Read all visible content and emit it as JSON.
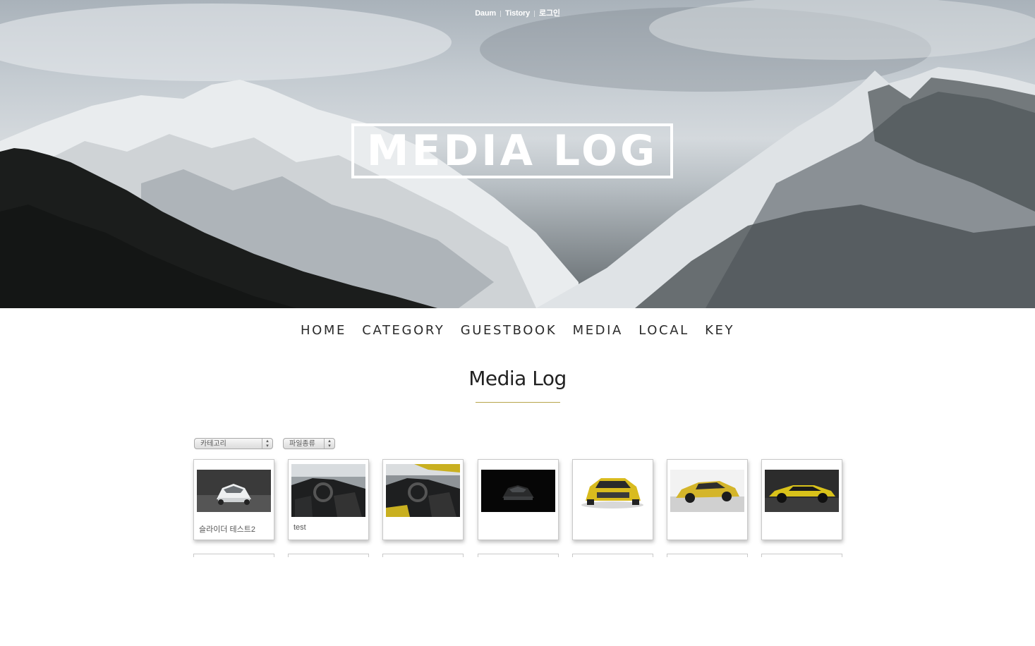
{
  "top_links": [
    "Daum",
    "Tistory",
    "로그인"
  ],
  "logo": "MEDIA LOG",
  "nav": [
    "HOME",
    "CATEGORY",
    "GUESTBOOK",
    "MEDIA",
    "LOCAL",
    "KEY"
  ],
  "page_title": "Media Log",
  "filters": {
    "category": "카테고리",
    "file_type": "파일종류"
  },
  "media_items": [
    {
      "caption": "슬라이더 테스트2",
      "image": "white-sports-car"
    },
    {
      "caption": "test",
      "image": "car-interior"
    },
    {
      "caption": "",
      "image": "car-interior-yellow"
    },
    {
      "caption": "",
      "image": "dark-car-front"
    },
    {
      "caption": "",
      "image": "yellow-car-rear"
    },
    {
      "caption": "",
      "image": "yellow-car-three-quarter"
    },
    {
      "caption": "",
      "image": "yellow-car-side"
    }
  ],
  "colors": {
    "accent_rule": "#b6a44a",
    "text": "#2b2b2b"
  }
}
